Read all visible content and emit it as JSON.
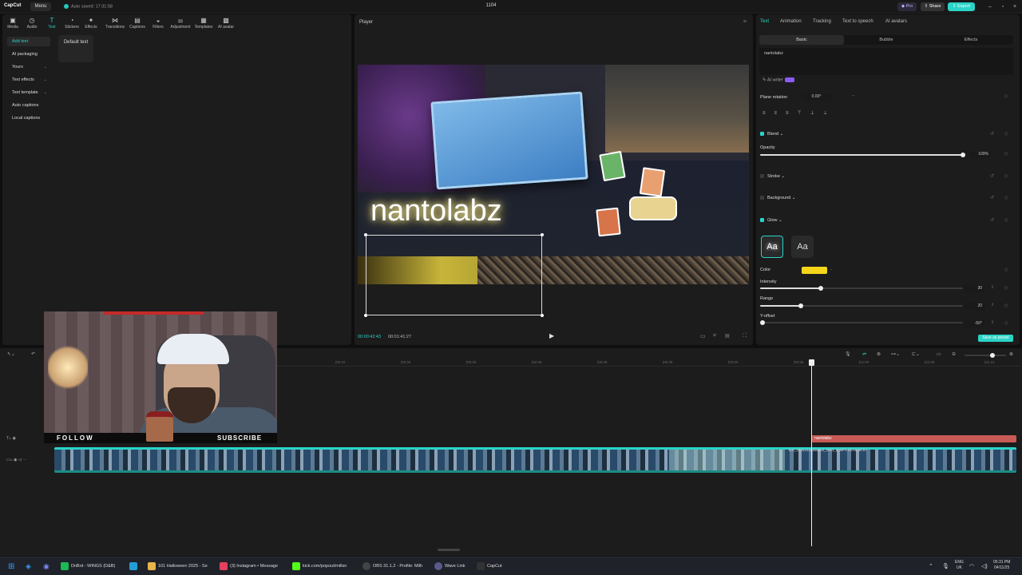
{
  "titlebar": {
    "app_name": "CapCut",
    "menu_label": "Menu",
    "autosave": "Auto saved: 17:31:58",
    "project_title": "1104",
    "pro_label": "Pro",
    "share_label": "Share",
    "export_label": "Export"
  },
  "toolbar": {
    "tools": [
      {
        "label": "Media",
        "icon": "media-icon"
      },
      {
        "label": "Audio",
        "icon": "audio-icon"
      },
      {
        "label": "Text",
        "icon": "text-icon"
      },
      {
        "label": "Stickers",
        "icon": "stickers-icon"
      },
      {
        "label": "Effects",
        "icon": "effects-icon"
      },
      {
        "label": "Transitions",
        "icon": "transitions-icon"
      },
      {
        "label": "Captions",
        "icon": "captions-icon"
      },
      {
        "label": "Filters",
        "icon": "filters-icon"
      },
      {
        "label": "Adjustment",
        "icon": "adjustment-icon"
      },
      {
        "label": "Templates",
        "icon": "templates-icon"
      },
      {
        "label": "AI avatar",
        "icon": "ai-avatar-icon"
      }
    ]
  },
  "sidebar": {
    "items": [
      {
        "label": "Add text"
      },
      {
        "label": "AI packaging"
      },
      {
        "label": "Yours"
      },
      {
        "label": "Text effects"
      },
      {
        "label": "Text template"
      },
      {
        "label": "Auto captions"
      },
      {
        "label": "Local captions"
      }
    ],
    "default_text_card": "Default text"
  },
  "player": {
    "title": "Player",
    "overlay_text": "nantolabz",
    "current_time": "00:00:42:43",
    "total_time": "00:01:41:27"
  },
  "inspector": {
    "tabs": [
      "Text",
      "Animation",
      "Tracking",
      "Text to speech",
      "AI avatars"
    ],
    "subtabs": [
      "Basic",
      "Bubble",
      "Effects"
    ],
    "text_value": "nantolabz",
    "ai_writer": "AI writer",
    "plane_rotation_label": "Plane rotation",
    "plane_rotation_value": "0.00°",
    "blend_label": "Blend",
    "opacity_label": "Opacity",
    "opacity_value": "100%",
    "opacity": 1.0,
    "stroke_label": "Stroke",
    "background_label": "Background",
    "glow_label": "Glow",
    "glow_preset_a": "Aa",
    "glow_preset_b": "Aa",
    "color_label": "Color",
    "glow_color": "#f5d51a",
    "intensity_label": "Intensity",
    "intensity_value": "30",
    "intensity": 30,
    "range_label": "Range",
    "range_value": "20",
    "range": 20,
    "yoffset_label": "Y-offset",
    "yoffset_value": "-50°",
    "save_preset": "Save as preset"
  },
  "timeline": {
    "ticks": [
      "|00:20",
      "|00:25",
      "|00:30",
      "|00:35",
      "|00:40",
      "|00:45",
      "|00:50",
      "|00:55",
      "|01:00",
      "|01:05",
      "|01:10"
    ],
    "text_clip_label": "nantolabz",
    "video_clip_label": "DJI_20251031162903_0003_D.MP4  00:00:58:57"
  },
  "webcam": {
    "follow": "FOLLOW",
    "subscribe": "SUBSCRIBE"
  },
  "taskbar": {
    "items": [
      {
        "label": "DnBot - WINGS (D&B)",
        "color": "#1db954"
      },
      {
        "label": "",
        "color": "#229ed9"
      },
      {
        "label": "101 Halloween 2025 - Se",
        "color": "#e8b64a"
      },
      {
        "label": "(3) Instagram • Message",
        "color": "#e4405f"
      },
      {
        "label": "kick.com/popout/millsn",
        "color": "#53fc18"
      },
      {
        "label": "OBS 31.1.2 - Profile: Milh",
        "color": "#444"
      },
      {
        "label": "Wave Link",
        "color": "#5a5a8a"
      },
      {
        "label": "CapCut",
        "color": "#333"
      }
    ],
    "lang": "ENG",
    "region": "UK",
    "time": "05:31 PM",
    "date": "04/11/25"
  }
}
